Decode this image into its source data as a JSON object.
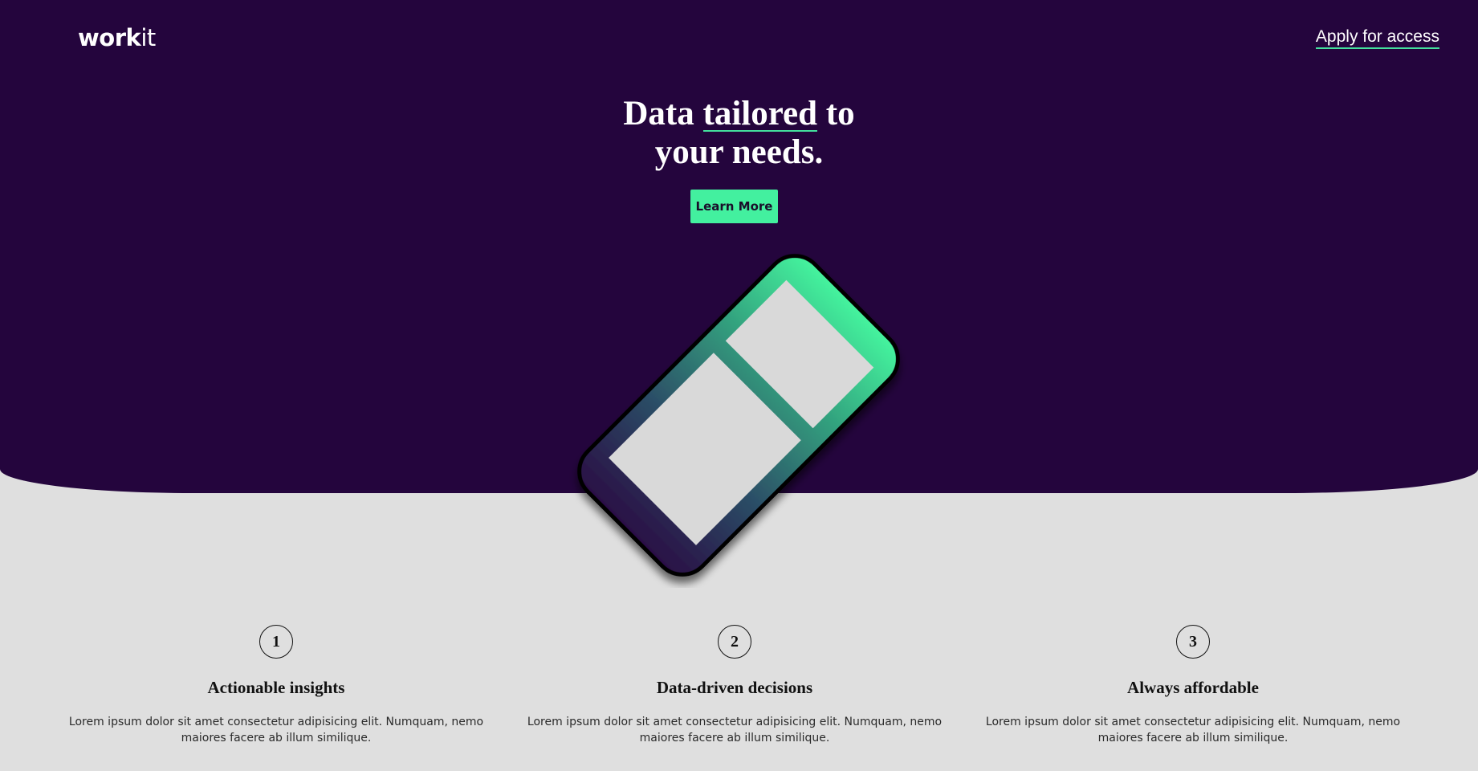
{
  "brand": {
    "logo_bold": "work",
    "logo_light": "it"
  },
  "nav": {
    "apply_label": "Apply for access"
  },
  "hero": {
    "headline_pre": "Data ",
    "headline_highlight": "tailored",
    "headline_post": " to",
    "headline_line2": "your needs.",
    "cta_label": "Learn More"
  },
  "features": [
    {
      "number": "1",
      "title": "Actionable insights",
      "description": "Lorem ipsum dolor sit amet consectetur adipisicing elit. Numquam, nemo maiores facere ab illum similique."
    },
    {
      "number": "2",
      "title": "Data-driven decisions",
      "description": "Lorem ipsum dolor sit amet consectetur adipisicing elit. Numquam, nemo maiores facere ab illum similique."
    },
    {
      "number": "3",
      "title": "Always affordable",
      "description": "Lorem ipsum dolor sit amet consectetur adipisicing elit. Numquam, nemo maiores facere ab illum similique."
    }
  ],
  "colors": {
    "hero_bg": "#24053d",
    "accent": "#43f09f",
    "page_bg": "#dfdfdf",
    "phone_panel": "#d9d9d9"
  }
}
